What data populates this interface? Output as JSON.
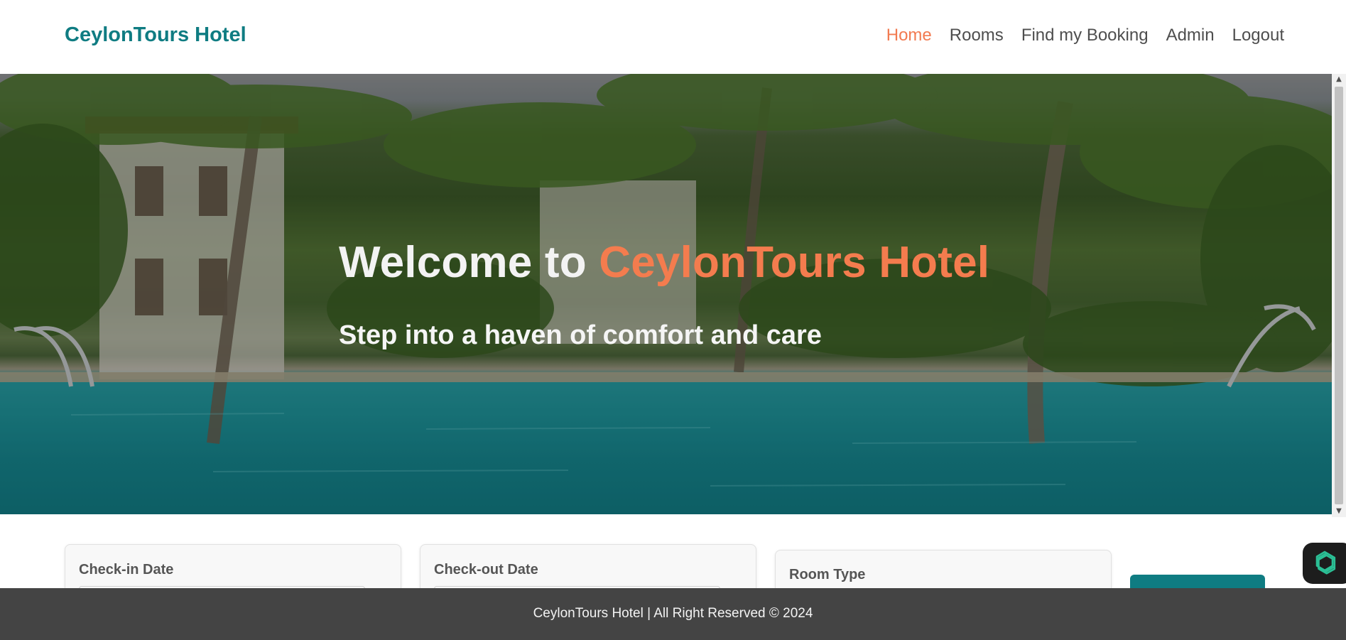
{
  "header": {
    "brand": "CeylonTours Hotel",
    "nav": [
      {
        "label": "Home",
        "active": true
      },
      {
        "label": "Rooms",
        "active": false
      },
      {
        "label": "Find my Booking",
        "active": false
      },
      {
        "label": "Admin",
        "active": false
      },
      {
        "label": "Logout",
        "active": false
      }
    ]
  },
  "hero": {
    "title_prefix": "Welcome to ",
    "title_accent": "CeylonTours Hotel",
    "subtitle": "Step into a haven of comfort and care",
    "background_image": "hotel-pool-palms"
  },
  "booking": {
    "checkin_label": "Check-in Date",
    "checkout_label": "Check-out Date",
    "room_type_label": "Room Type",
    "checkin_value": "",
    "checkout_value": "",
    "room_type_value": ""
  },
  "footer": {
    "text": "CeylonTours Hotel | All Right Reserved © 2024"
  },
  "widgets": {
    "chat_icon": "openai-chat-icon"
  },
  "colors": {
    "brand": "#0f7c82",
    "accent": "#f47c4e",
    "nav_text": "#4e4e4e",
    "footer_bg": "#444444"
  }
}
